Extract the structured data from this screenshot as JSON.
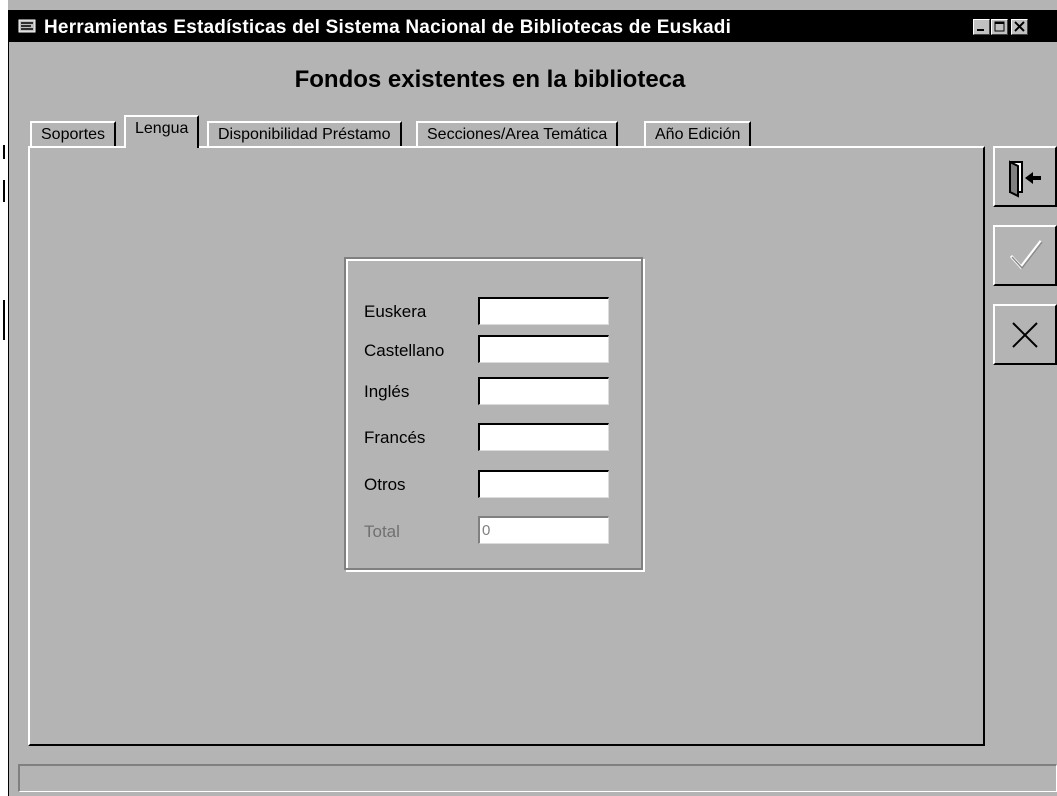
{
  "window": {
    "title": "Herramientas Estadísticas del Sistema Nacional de Bibliotecas de Euskadi",
    "icon": "app-icon",
    "controls": [
      "minimize-icon",
      "maximize-icon",
      "close-icon"
    ]
  },
  "heading": "Fondos existentes en la biblioteca",
  "tabs": [
    {
      "label": "Soportes",
      "active": false
    },
    {
      "label": "Lengua",
      "active": true
    },
    {
      "label": "Disponibilidad Préstamo",
      "active": false
    },
    {
      "label": "Secciones/Area Temática",
      "active": false
    },
    {
      "label": "Año Edición",
      "active": false
    }
  ],
  "form": {
    "fields": [
      {
        "label": "Euskera",
        "value": ""
      },
      {
        "label": "Castellano",
        "value": ""
      },
      {
        "label": "Inglés",
        "value": ""
      },
      {
        "label": "Francés",
        "value": ""
      },
      {
        "label": "Otros",
        "value": ""
      },
      {
        "label": "Total",
        "value": "0",
        "disabled": true
      }
    ]
  },
  "toolbar": {
    "buttons": [
      {
        "icon": "exit-door-icon",
        "enabled": true
      },
      {
        "icon": "checkmark-icon",
        "enabled": false
      },
      {
        "icon": "cancel-x-icon",
        "enabled": true
      }
    ]
  },
  "colors": {
    "background": "#b4b4b4",
    "titlebar": "#000000",
    "disabled_text": "#707070"
  }
}
